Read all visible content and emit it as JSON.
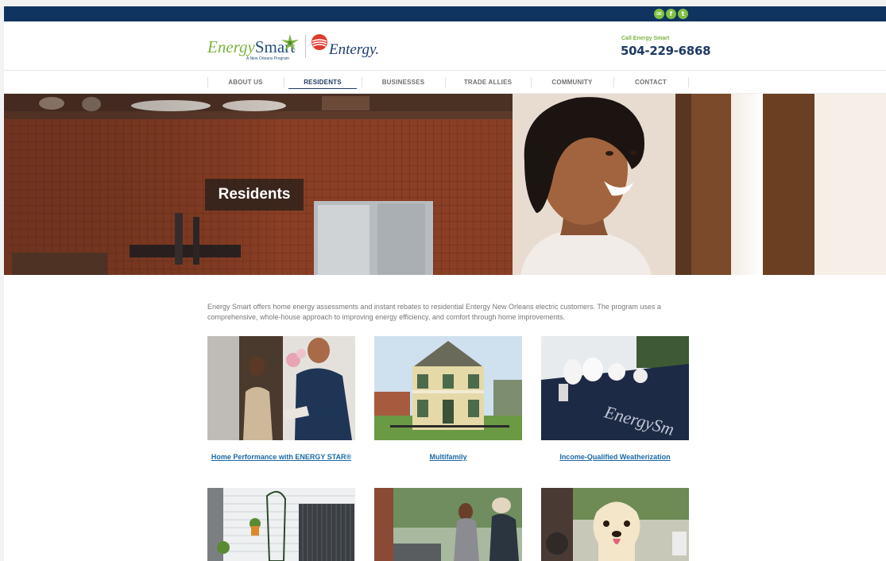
{
  "topbar": {
    "social_icons": [
      {
        "icon": "email-icon",
        "glyph": "✉"
      },
      {
        "icon": "facebook-icon",
        "glyph": "f"
      },
      {
        "icon": "twitter-icon",
        "glyph": "t"
      }
    ],
    "accent": "#7fc241",
    "background": "#0f3460"
  },
  "header": {
    "logo_energy": "Energy",
    "logo_smart": "Smart",
    "logo_tagline": "A New Orleans Program",
    "partner_logo": "Entergy.",
    "call_label": "Call Energy Smart",
    "phone": "504-229-6868"
  },
  "nav": {
    "items": [
      {
        "label": "ABOUT US"
      },
      {
        "label": "RESIDENTS",
        "active": true
      },
      {
        "label": "BUSINESSES"
      },
      {
        "label": "TRADE ALLIES"
      },
      {
        "label": "COMMUNITY"
      },
      {
        "label": "CONTACT"
      }
    ]
  },
  "hero": {
    "title": "Residents"
  },
  "intro": {
    "text": "Energy Smart offers home energy assessments and instant rebates to residential Entergy New Orleans electric customers. The program uses a comprehensive, whole-house approach to improving energy efficiency, and comfort through home improvements."
  },
  "cards": [
    {
      "label": "Home Performance with ENERGY STAR®"
    },
    {
      "label": "Multifamily"
    },
    {
      "label": "Income-Qualified Weatherization"
    }
  ],
  "colors": {
    "brand_navy": "#1f3b63",
    "brand_green": "#7cb342",
    "link": "#1d6aa5"
  }
}
